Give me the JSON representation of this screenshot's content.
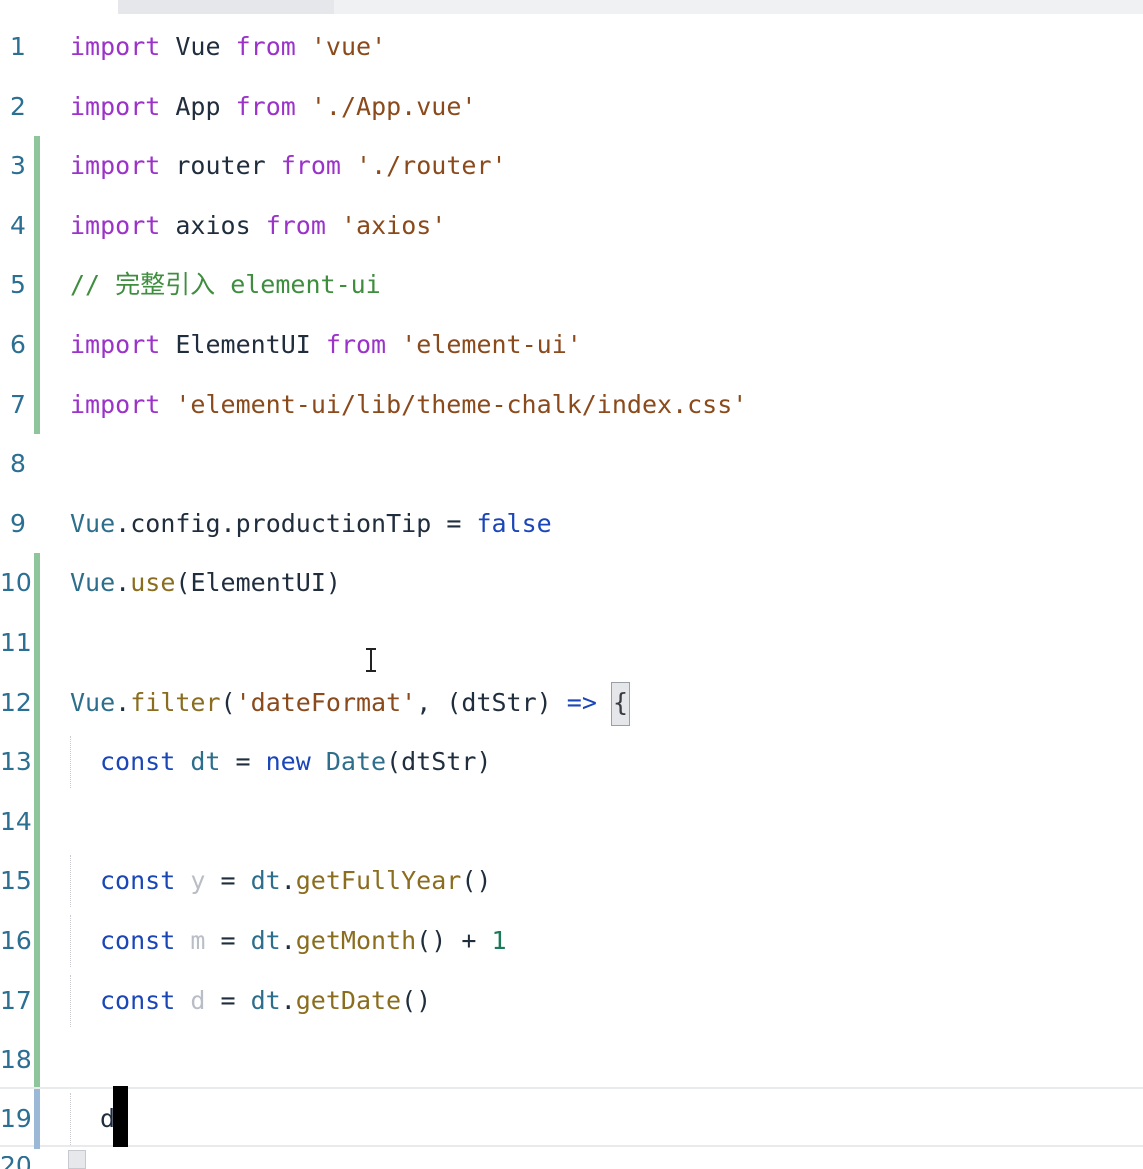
{
  "editor": {
    "language": "javascript",
    "current_line": 19,
    "colors": {
      "keyword": "#9b33c9",
      "keyword_blue": "#1b46b8",
      "string": "#8a4a1b",
      "comment": "#3f8d3f",
      "line_number": "#2b6f93",
      "modified_gutter": "#8fc59a",
      "active_gutter": "#9bb9d6"
    },
    "lines": [
      {
        "n": "1",
        "t": [
          "import",
          "Vue",
          "from",
          "'vue'"
        ]
      },
      {
        "n": "2",
        "t": [
          "import",
          "App",
          "from",
          "'./App.vue'"
        ]
      },
      {
        "n": "3",
        "t": [
          "import",
          "router",
          "from",
          "'./router'"
        ]
      },
      {
        "n": "4",
        "t": [
          "import",
          "axios",
          "from",
          "'axios'"
        ]
      },
      {
        "n": "5",
        "t": [
          "// 完整引入 element-ui"
        ]
      },
      {
        "n": "6",
        "t": [
          "import",
          "ElementUI",
          "from",
          "'element-ui'"
        ]
      },
      {
        "n": "7",
        "t": [
          "import",
          "'element-ui/lib/theme-chalk/index.css'"
        ]
      },
      {
        "n": "8",
        "t": []
      },
      {
        "n": "9",
        "t": [
          "Vue",
          ".",
          "config",
          ".",
          "productionTip",
          "=",
          "false"
        ]
      },
      {
        "n": "10",
        "t": [
          "Vue",
          ".",
          "use",
          "(",
          "ElementUI",
          ")"
        ]
      },
      {
        "n": "11",
        "t": []
      },
      {
        "n": "12",
        "t": [
          "Vue",
          ".",
          "filter",
          "(",
          "'dateFormat'",
          ",",
          "(",
          "dtStr",
          ")",
          "=>",
          "{"
        ]
      },
      {
        "n": "13",
        "t": [
          "const",
          "dt",
          "=",
          "new",
          "Date",
          "(",
          "dtStr",
          ")"
        ]
      },
      {
        "n": "14",
        "t": []
      },
      {
        "n": "15",
        "t": [
          "const",
          "y",
          "=",
          "dt",
          ".",
          "getFullYear",
          "()"
        ]
      },
      {
        "n": "16",
        "t": [
          "const",
          "m",
          "=",
          "dt",
          ".",
          "getMonth",
          "()",
          "+",
          "1"
        ]
      },
      {
        "n": "17",
        "t": [
          "const",
          "d",
          "=",
          "dt",
          ".",
          "getDate",
          "()"
        ]
      },
      {
        "n": "18",
        "t": []
      },
      {
        "n": "19",
        "t": [
          "d"
        ]
      }
    ]
  }
}
